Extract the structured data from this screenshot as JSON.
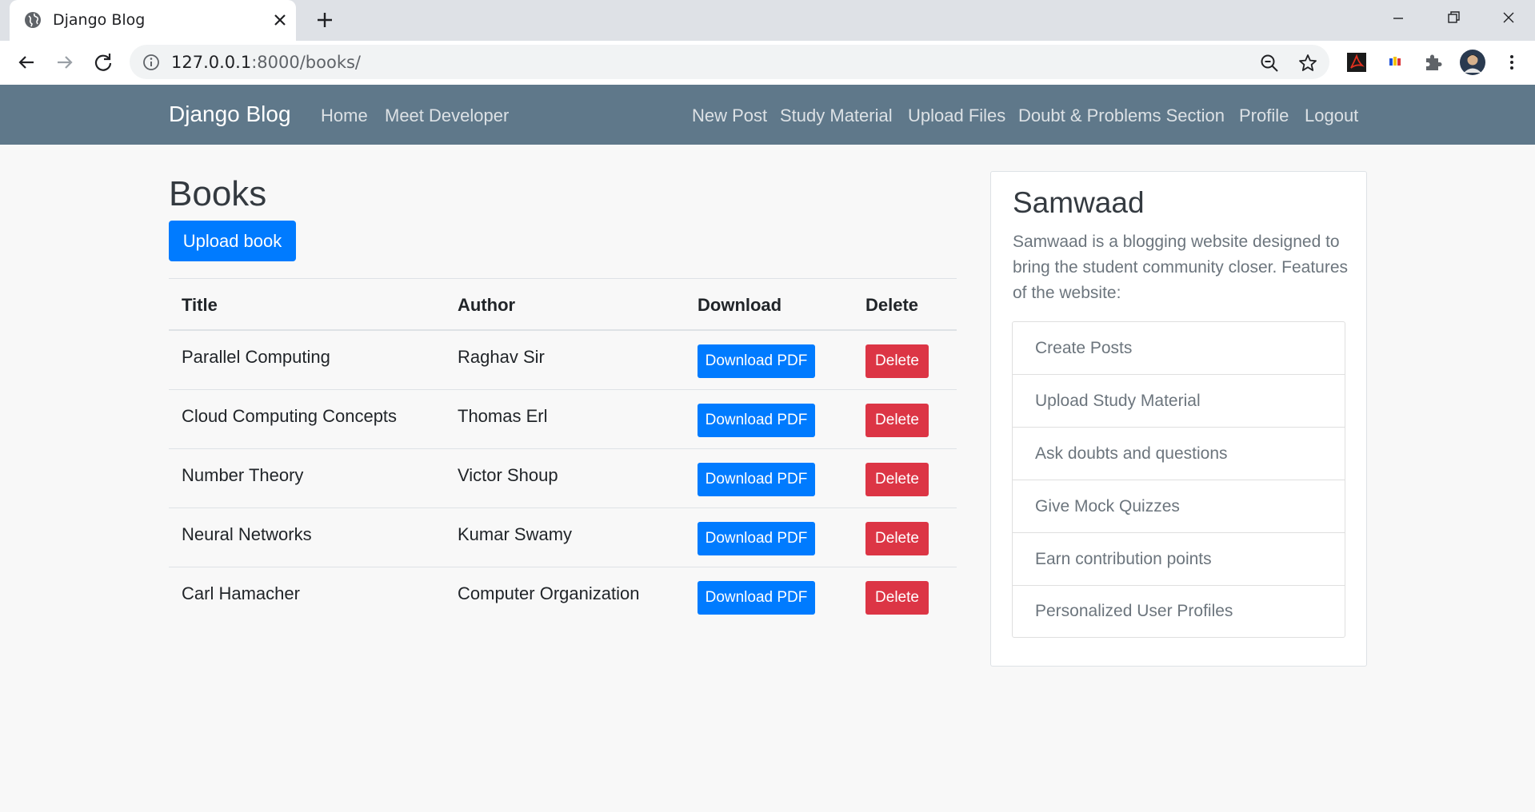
{
  "browser": {
    "tab_title": "Django Blog",
    "url_host": "127.0.0.1",
    "url_path": ":8000/books/"
  },
  "navbar": {
    "brand": "Django Blog",
    "left_links": [
      "Home",
      "Meet Developer"
    ],
    "right_links": [
      "New Post",
      "Study Material",
      "Upload Files",
      "Doubt & Problems Section",
      "Profile",
      "Logout"
    ]
  },
  "main": {
    "heading": "Books",
    "upload_button": "Upload book",
    "table": {
      "headers": [
        "Title",
        "Author",
        "Download",
        "Delete"
      ],
      "rows": [
        {
          "title": "Parallel Computing",
          "author": "Raghav Sir",
          "download": "Download PDF",
          "delete": "Delete"
        },
        {
          "title": "Cloud Computing Concepts",
          "author": "Thomas Erl",
          "download": "Download PDF",
          "delete": "Delete"
        },
        {
          "title": "Number Theory",
          "author": "Victor Shoup",
          "download": "Download PDF",
          "delete": "Delete"
        },
        {
          "title": "Neural Networks",
          "author": "Kumar Swamy",
          "download": "Download PDF",
          "delete": "Delete"
        },
        {
          "title": "Carl Hamacher",
          "author": "Computer Organization",
          "download": "Download PDF",
          "delete": "Delete"
        }
      ]
    }
  },
  "sidebar": {
    "title": "Samwaad",
    "description": "Samwaad is a blogging website designed to bring the student community closer. Features of the website:",
    "items": [
      "Create Posts",
      "Upload Study Material",
      "Ask doubts and questions",
      "Give Mock Quizzes",
      "Earn contribution points",
      "Personalized User Profiles"
    ]
  },
  "colors": {
    "navbar_bg": "#5f788a",
    "primary": "#007bff",
    "danger": "#dc3545"
  }
}
